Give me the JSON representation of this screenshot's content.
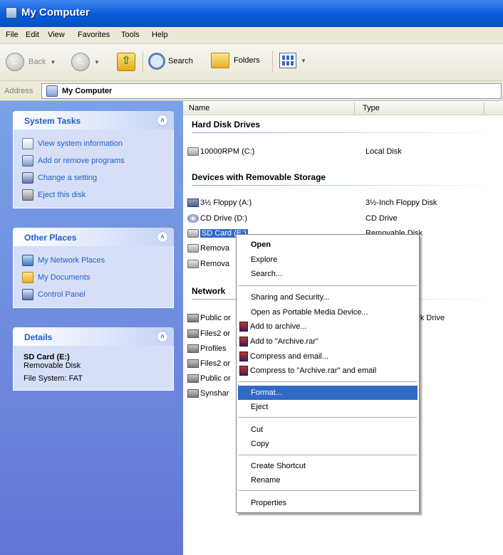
{
  "window": {
    "title": "My Computer"
  },
  "menubar": [
    "File",
    "Edit",
    "View",
    "Favorites",
    "Tools",
    "Help"
  ],
  "toolbar": {
    "back": "Back",
    "search": "Search",
    "folders": "Folders"
  },
  "address": {
    "label": "Address",
    "value": "My Computer"
  },
  "left": {
    "system_tasks": {
      "title": "System Tasks",
      "items": [
        "View system information",
        "Add or remove programs",
        "Change a setting",
        "Eject this disk"
      ]
    },
    "other_places": {
      "title": "Other Places",
      "items": [
        "My Network Places",
        "My Documents",
        "Control Panel"
      ]
    },
    "details": {
      "title": "Details",
      "name": "SD Card (E:)",
      "type": "Removable Disk",
      "fs": "File System: FAT"
    }
  },
  "columns": {
    "name": "Name",
    "type": "Type"
  },
  "groups": {
    "hdd": "Hard Disk Drives",
    "removable": "Devices with Removable Storage",
    "network": "Network"
  },
  "rows": {
    "c": {
      "name": "10000RPM (C:)",
      "type": "Local Disk"
    },
    "a": {
      "name": "3½ Floppy (A:)",
      "type": "3½-Inch Floppy Disk"
    },
    "d": {
      "name": "CD Drive (D:)",
      "type": "CD Drive"
    },
    "e": {
      "name": "SD Card (E:)",
      "type": "Removable Disk"
    },
    "rem1": {
      "name": "Remova",
      "type": "k"
    },
    "rem2": {
      "name": "Remova",
      "type": "k"
    },
    "net1": {
      "name": "Public or",
      "type": "Network Drive"
    },
    "net2": {
      "name": "Files2 or",
      "type": ""
    },
    "net3": {
      "name": "Profiles",
      "type": ""
    },
    "net4": {
      "name": "Files2 or",
      "type": ""
    },
    "net5": {
      "name": "Public or",
      "type": ""
    },
    "net6": {
      "name": "Synshar",
      "type": ""
    }
  },
  "context_menu": {
    "open": "Open",
    "explore": "Explore",
    "search": "Search...",
    "sharing": "Sharing and Security...",
    "portable": "Open as Portable Media Device...",
    "add_archive": "Add to archive...",
    "add_rar": "Add to \"Archive.rar\"",
    "compress_email": "Compress and email...",
    "compress_rar_email": "Compress to \"Archive.rar\" and email",
    "format": "Format...",
    "eject": "Eject",
    "cut": "Cut",
    "copy": "Copy",
    "create_shortcut": "Create Shortcut",
    "rename": "Rename",
    "properties": "Properties"
  }
}
